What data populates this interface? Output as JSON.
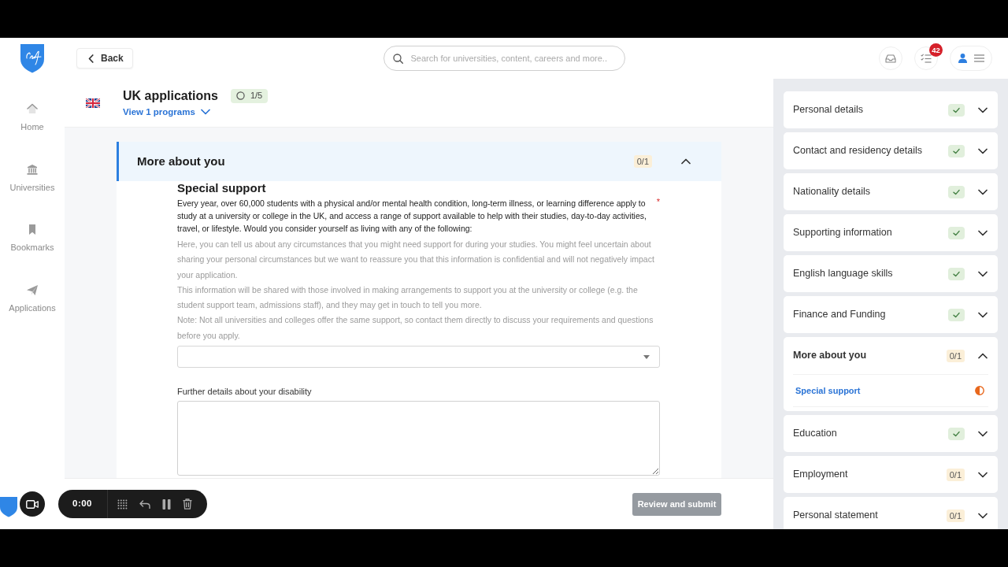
{
  "header": {
    "back_label": "Back",
    "search": {
      "placeholder": "Search for universities, content, careers and more.."
    },
    "notification_count": "42"
  },
  "nav": [
    {
      "label": "Home"
    },
    {
      "label": "Universities"
    },
    {
      "label": "Bookmarks"
    },
    {
      "label": "Applications"
    }
  ],
  "application": {
    "title": "UK applications",
    "progress": "1/5",
    "programs_link": "View 1 programs"
  },
  "section": {
    "title": "More about you",
    "progress": "0/1",
    "expanded": true,
    "question": {
      "heading": "Special support",
      "text": "Every year, over 60,000 students with a physical and/or mental health condition, long-term illness, or learning difference apply to study at a university or college in the UK, and access a range of support available to help with their studies, day-to-day activities, travel, or lifestyle. Would you consider yourself as living with any of the following:",
      "required": true,
      "required_mark": "*",
      "help": [
        "Here, you can tell us about any circumstances that you might need support for during your studies. You might feel uncertain about sharing your personal circumstances but we want to reassure you that this information is confidential and will not negatively impact your application.",
        "This information will be shared with those involved in making arrangements to support you at the university or college (e.g. the student support team, admissions staff), and they may get in touch to tell you more.",
        "Note: Not all universities and colleges offer the same support, so contact them directly to discuss your requirements and questions before you apply."
      ]
    },
    "details_label": "Further details about your disability"
  },
  "review_button": {
    "label": "Review and submit",
    "disabled": true
  },
  "steps": [
    {
      "label": "Personal details",
      "kind": "complete",
      "expanded": false
    },
    {
      "label": "Contact and residency details",
      "kind": "complete",
      "expanded": false
    },
    {
      "label": "Nationality details",
      "kind": "complete",
      "expanded": false
    },
    {
      "label": "Supporting information",
      "kind": "complete",
      "expanded": false
    },
    {
      "label": "English language skills",
      "kind": "complete",
      "expanded": false
    },
    {
      "label": "Finance and Funding",
      "kind": "complete",
      "expanded": false
    },
    {
      "label": "More about you",
      "kind": "partial",
      "progress": "0/1",
      "expanded": true,
      "children": [
        {
          "label": "Special support",
          "kind": "partial",
          "selected": true
        }
      ]
    },
    {
      "label": "Education",
      "kind": "complete",
      "expanded": false
    },
    {
      "label": "Employment",
      "kind": "partial",
      "progress": "0/1",
      "expanded": false
    },
    {
      "label": "Personal statement",
      "kind": "partial",
      "progress": "0/1",
      "expanded": false
    }
  ],
  "recorder": {
    "time": "0:00"
  }
}
